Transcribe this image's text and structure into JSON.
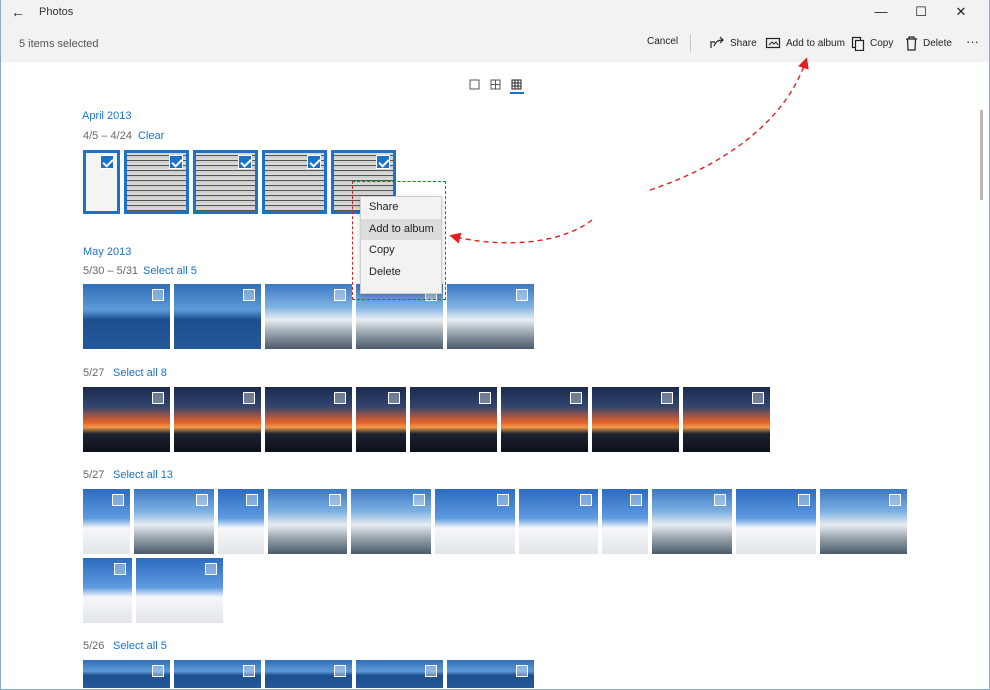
{
  "window": {
    "title": "Photos",
    "controls": {
      "minimize": "—",
      "maximize": "☐",
      "close": "✕"
    }
  },
  "commandbar": {
    "selection_count": "5 items selected",
    "cancel": "Cancel",
    "share": "Share",
    "add_to_album": "Add to album",
    "copy": "Copy",
    "delete": "Delete",
    "more": "···"
  },
  "groups": [
    {
      "month": "April 2013",
      "range": "4/5 – 4/24",
      "action": "Clear",
      "items": 5,
      "selected": 5
    },
    {
      "month": "May 2013",
      "range": "5/30 – 5/31",
      "action": "Select all 5",
      "items": 5
    },
    {
      "range": "5/27",
      "action": "Select all 8",
      "items": 8
    },
    {
      "range": "5/27",
      "action": "Select all 13",
      "items": 13
    },
    {
      "range": "5/26",
      "action": "Select all 5",
      "items": 5
    }
  ],
  "context_menu": {
    "items": [
      "Share",
      "Add to album",
      "Copy",
      "Delete"
    ],
    "highlighted": "Add to album"
  },
  "colors": {
    "accent": "#1a73c8",
    "annotation": "#e02020"
  }
}
